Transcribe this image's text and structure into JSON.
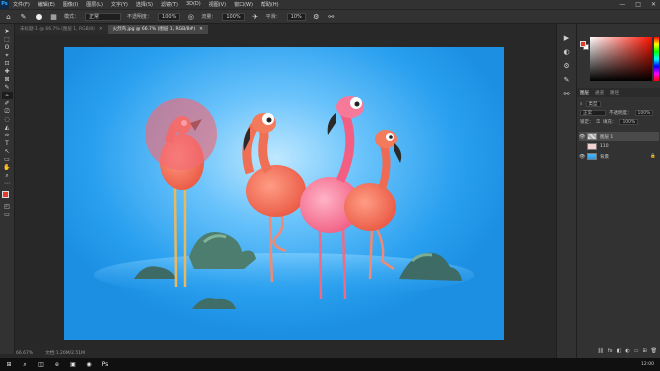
{
  "app": {
    "logo": "Ps",
    "menu": [
      "文件(F)",
      "编辑(E)",
      "图像(I)",
      "图层(L)",
      "文字(Y)",
      "选择(S)",
      "滤镜(T)",
      "3D(D)",
      "视图(V)",
      "窗口(W)",
      "帮助(H)"
    ],
    "window_controls": [
      "—",
      "□",
      "✕"
    ]
  },
  "options": {
    "mode_label": "模式：",
    "mode_value": "正常",
    "opacity_label": "不透明度：",
    "opacity_value": "100%",
    "flow_label": "流量：",
    "flow_value": "100%",
    "smooth_label": "平滑：",
    "smooth_value": "10%"
  },
  "tabs": [
    {
      "label": "未标题-1 @ 66.7% (图层 1, RGB/8)",
      "close": "✕",
      "active": false
    },
    {
      "label": "火烈鸟.jpg @ 66.7% (图层 1, RGB/8#)",
      "close": "✕",
      "active": true
    }
  ],
  "tools": [
    "➤",
    "⬚",
    "ʘ",
    "⌖",
    "⊡",
    "✚",
    "⊠",
    "✎",
    "⌁",
    "✐",
    "⎚",
    "◌",
    "◭",
    "✑",
    "T",
    "↖",
    "▭",
    "✋",
    "⌕",
    "⋯"
  ],
  "panel_strip_icons": [
    "▶",
    "◐",
    "⚙",
    "✎",
    "⚯"
  ],
  "layers": {
    "tabs": [
      {
        "label": "图层",
        "active": true
      },
      {
        "label": "通道",
        "active": false
      },
      {
        "label": "路径",
        "active": false
      }
    ],
    "kind_label": "类型",
    "blend_mode": "正常",
    "opacity_label": "不透明度：",
    "opacity_value": "100%",
    "lock_label": "锁定：",
    "fill_label": "填充：",
    "fill_value": "100%",
    "rows": [
      {
        "name": "图层 1",
        "thumb": "checker",
        "selected": true,
        "lock": ""
      },
      {
        "name": "110",
        "thumb": "pink",
        "selected": false,
        "lock": ""
      },
      {
        "name": "背景",
        "thumb": "bg",
        "selected": false,
        "lock": "🔒"
      }
    ],
    "bottom_icons": [
      "⛓",
      "fx",
      "◧",
      "◐",
      "▭",
      "⊞",
      "🗑"
    ]
  },
  "status": {
    "zoom": "66.67%",
    "doc": "文档:1.20M/2.51M"
  },
  "taskbar": {
    "icons": [
      "⊞",
      "⌕",
      "◫",
      "e",
      "▣",
      "◉",
      "Ps"
    ],
    "clock": "12:00"
  },
  "colors": {
    "foreground": "#e53a2c",
    "background": "#ffffff",
    "accent": "#31a8ff"
  }
}
